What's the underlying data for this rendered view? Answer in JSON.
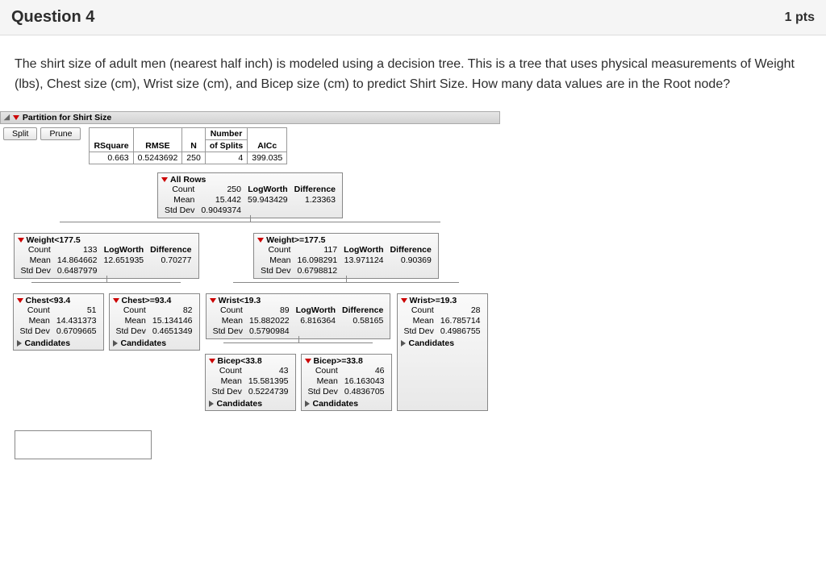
{
  "header": {
    "title": "Question 4",
    "points": "1 pts"
  },
  "prompt": "The shirt size of adult men (nearest half inch) is modeled using a decision tree. This is a tree that uses physical measurements of Weight (lbs), Chest size (cm), Wrist size (cm), and Bicep size (cm) to predict Shirt Size. How many data values are in the Root node?",
  "panel_title": "Partition for Shirt Size",
  "buttons": {
    "split": "Split",
    "prune": "Prune"
  },
  "summary": {
    "cols": {
      "rsq": "RSquare",
      "rmse": "RMSE",
      "n": "N",
      "numsplits_top": "Number",
      "numsplits_bot": "of Splits",
      "aicc": "AICc"
    },
    "vals": {
      "rsq": "0.663",
      "rmse": "0.5243692",
      "n": "250",
      "numsplits": "4",
      "aicc": "399.035"
    }
  },
  "labels": {
    "count": "Count",
    "mean": "Mean",
    "stddev": "Std Dev",
    "logworth": "LogWorth",
    "difference": "Difference",
    "candidates": "Candidates"
  },
  "root": {
    "title": "All Rows",
    "count": "250",
    "mean": "15.442",
    "std": "0.9049374",
    "lw": "59.943429",
    "diff": "1.23363"
  },
  "l": {
    "title": "Weight<177.5",
    "count": "133",
    "mean": "14.864662",
    "std": "0.6487979",
    "lw": "12.651935",
    "diff": "0.70277"
  },
  "r": {
    "title": "Weight>=177.5",
    "count": "117",
    "mean": "16.098291",
    "std": "0.6798812",
    "lw": "13.971124",
    "diff": "0.90369"
  },
  "ll": {
    "title": "Chest<93.4",
    "count": "51",
    "mean": "14.431373",
    "std": "0.6709665"
  },
  "lr": {
    "title": "Chest>=93.4",
    "count": "82",
    "mean": "15.134146",
    "std": "0.4651349"
  },
  "rl": {
    "title": "Wrist<19.3",
    "count": "89",
    "mean": "15.882022",
    "std": "0.5790984",
    "lw": "6.816364",
    "diff": "0.58165"
  },
  "rr": {
    "title": "Wrist>=19.3",
    "count": "28",
    "mean": "16.785714",
    "std": "0.4986755"
  },
  "rll": {
    "title": "Bicep<33.8",
    "count": "43",
    "mean": "15.581395",
    "std": "0.5224739"
  },
  "rlr": {
    "title": "Bicep>=33.8",
    "count": "46",
    "mean": "16.163043",
    "std": "0.4836705"
  }
}
